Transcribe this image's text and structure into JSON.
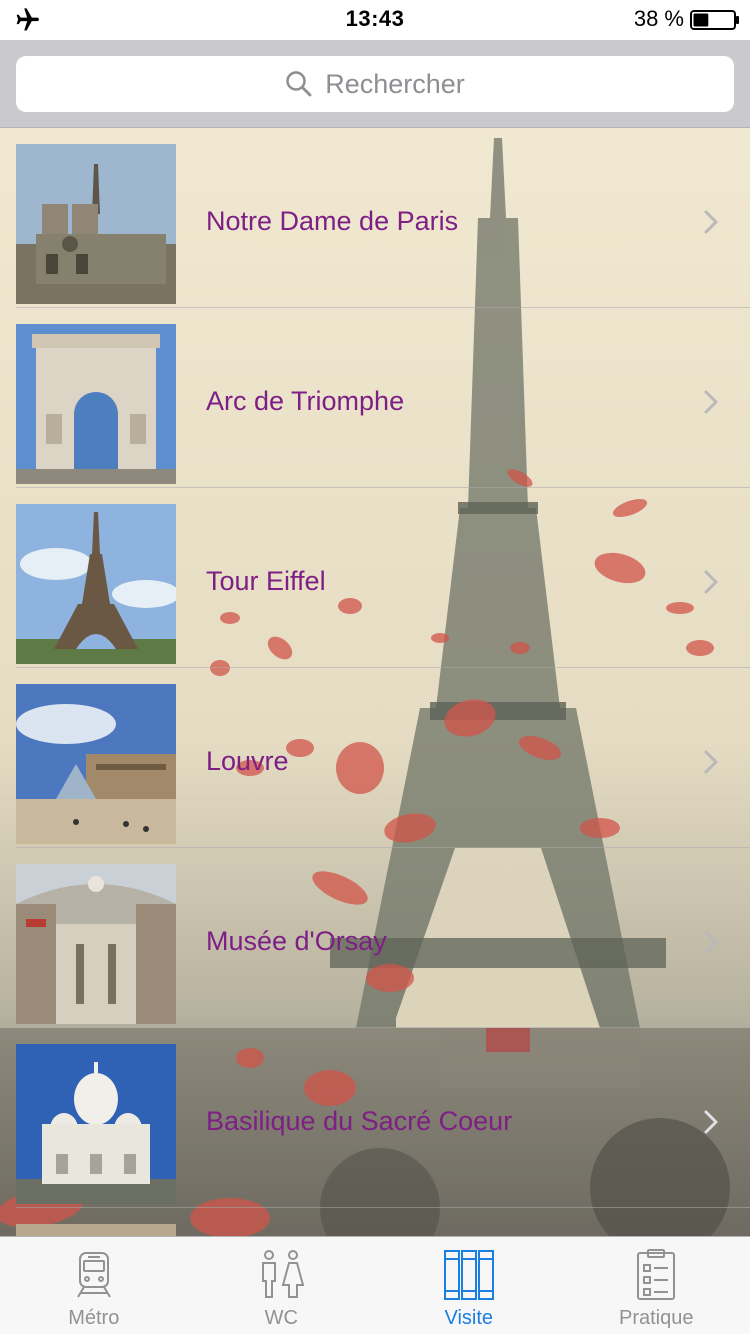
{
  "status_bar": {
    "time": "13:43",
    "battery_percent": "38 %",
    "battery_level": 0.38,
    "airplane_icon": "airplane-icon"
  },
  "search": {
    "placeholder": "Rechercher",
    "icon": "search-icon"
  },
  "list": {
    "items": [
      {
        "label": "Notre Dame de Paris",
        "thumb": "notre-dame"
      },
      {
        "label": "Arc de Triomphe",
        "thumb": "arc-de-triomphe"
      },
      {
        "label": "Tour Eiffel",
        "thumb": "tour-eiffel"
      },
      {
        "label": "Louvre",
        "thumb": "louvre"
      },
      {
        "label": "Musée d'Orsay",
        "thumb": "musee-orsay"
      },
      {
        "label": "Basilique du Sacré Coeur",
        "thumb": "sacre-coeur"
      }
    ],
    "label_color": "#7e1f86"
  },
  "tab_bar": {
    "tabs": [
      {
        "label": "Métro",
        "icon": "train-icon",
        "active": false
      },
      {
        "label": "WC",
        "icon": "restroom-icon",
        "active": false
      },
      {
        "label": "Visite",
        "icon": "books-icon",
        "active": true
      },
      {
        "label": "Pratique",
        "icon": "clipboard-icon",
        "active": false
      }
    ],
    "active_color": "#1a7fe0",
    "inactive_color": "#929292"
  }
}
